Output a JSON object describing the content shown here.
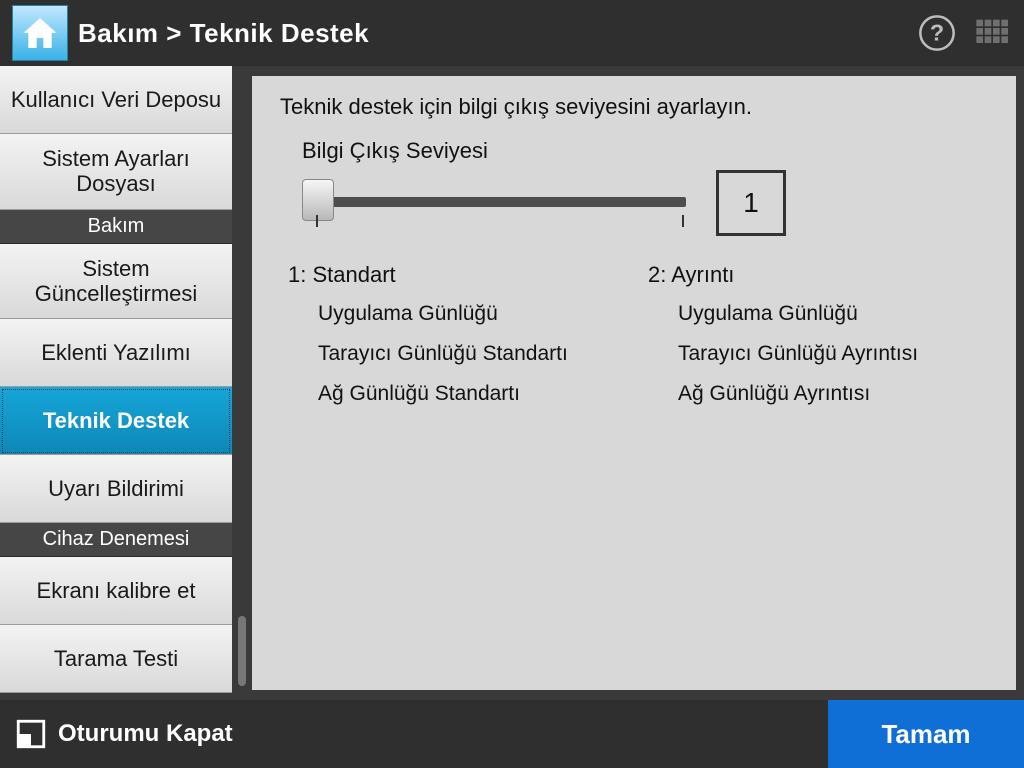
{
  "header": {
    "breadcrumb": "Bakım  >  Teknik Destek"
  },
  "sidebar": {
    "items": [
      {
        "type": "item",
        "label": "Kullanıcı Veri Deposu"
      },
      {
        "type": "item",
        "label": "Sistem Ayarları Dosyası"
      },
      {
        "type": "header",
        "label": "Bakım"
      },
      {
        "type": "item",
        "label": "Sistem Güncelleştirmesi"
      },
      {
        "type": "item",
        "label": "Eklenti Yazılımı"
      },
      {
        "type": "item",
        "label": "Teknik Destek",
        "active": true
      },
      {
        "type": "item",
        "label": "Uyarı Bildirimi"
      },
      {
        "type": "header",
        "label": "Cihaz Denemesi"
      },
      {
        "type": "item",
        "label": "Ekranı kalibre et"
      },
      {
        "type": "item",
        "label": "Tarama Testi"
      }
    ]
  },
  "main": {
    "intro": "Teknik destek için bilgi çıkış seviyesini ayarlayın.",
    "slider_label": "Bilgi Çıkış Seviyesi",
    "slider_value": "1",
    "level1": {
      "title": "1: Standart",
      "items": [
        "Uygulama Günlüğü",
        "Tarayıcı Günlüğü Standartı",
        "Ağ Günlüğü Standartı"
      ]
    },
    "level2": {
      "title": "2: Ayrıntı",
      "items": [
        "Uygulama Günlüğü",
        "Tarayıcı Günlüğü Ayrıntısı",
        "Ağ Günlüğü Ayrıntısı"
      ]
    }
  },
  "footer": {
    "logoff": "Oturumu Kapat",
    "ok": "Tamam"
  }
}
